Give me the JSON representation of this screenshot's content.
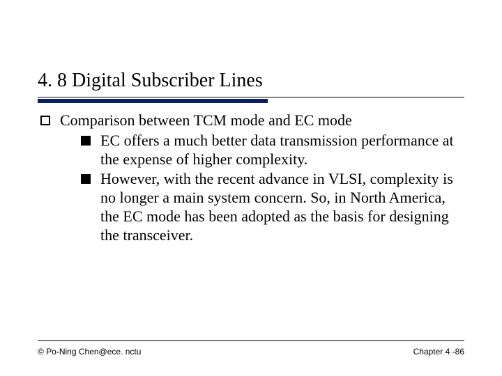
{
  "title": "4. 8 Digital Subscriber Lines",
  "body": {
    "level1": "Comparison between TCM mode and EC mode",
    "level2": [
      "EC offers a much better data transmission performance at the expense of higher complexity.",
      "However, with the recent advance in VLSI, complexity is no longer a main system concern. So, in North America, the EC mode has been adopted as the basis for designing the transceiver."
    ]
  },
  "footer": {
    "left": "© Po-Ning Chen@ece. nctu",
    "right": "Chapter 4 -86"
  }
}
